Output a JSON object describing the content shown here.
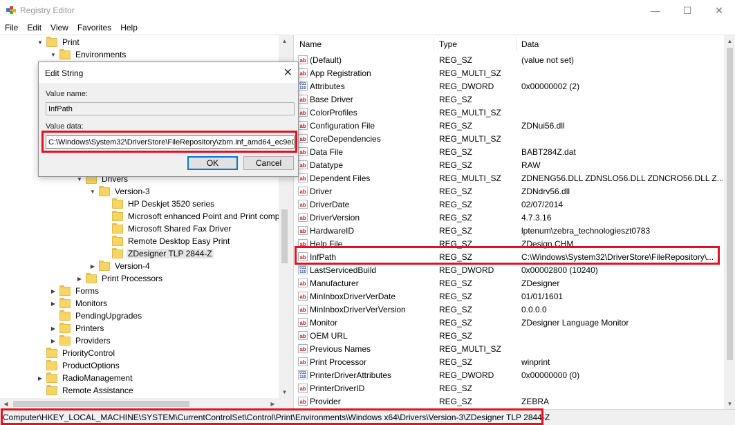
{
  "window": {
    "title": "Registry Editor",
    "minimize": "—",
    "maximize": "☐",
    "close": "✕"
  },
  "menu": [
    "File",
    "Edit",
    "View",
    "Favorites",
    "Help"
  ],
  "tree": [
    {
      "label": "Print",
      "depth": 3,
      "chev": "down"
    },
    {
      "label": "Environments",
      "depth": 4,
      "chev": "down"
    },
    {
      "label": "",
      "depth": 5,
      "chev": "none"
    },
    {
      "label": "",
      "depth": 5,
      "chev": "none"
    },
    {
      "label": "",
      "depth": 5,
      "chev": "none"
    },
    {
      "label": "",
      "depth": 5,
      "chev": "none"
    },
    {
      "label": "",
      "depth": 5,
      "chev": "none"
    },
    {
      "label": "",
      "depth": 5,
      "chev": "none"
    },
    {
      "label": "",
      "depth": 5,
      "chev": "none"
    },
    {
      "label": "",
      "depth": 5,
      "chev": "none"
    },
    {
      "label": "",
      "depth": 5,
      "chev": "none"
    },
    {
      "label": "Drivers",
      "depth": 6,
      "chev": "down"
    },
    {
      "label": "Version-3",
      "depth": 7,
      "chev": "down"
    },
    {
      "label": "HP Deskjet 3520 series",
      "depth": 8,
      "chev": "none"
    },
    {
      "label": "Microsoft enhanced Point and Print compa",
      "depth": 8,
      "chev": "none"
    },
    {
      "label": "Microsoft Shared Fax Driver",
      "depth": 8,
      "chev": "none"
    },
    {
      "label": "Remote Desktop Easy Print",
      "depth": 8,
      "chev": "none"
    },
    {
      "label": "ZDesigner TLP 2844-Z",
      "depth": 8,
      "chev": "none",
      "selected": true
    },
    {
      "label": "Version-4",
      "depth": 7,
      "chev": "right"
    },
    {
      "label": "Print Processors",
      "depth": 6,
      "chev": "right"
    },
    {
      "label": "Forms",
      "depth": 4,
      "chev": "right"
    },
    {
      "label": "Monitors",
      "depth": 4,
      "chev": "right"
    },
    {
      "label": "PendingUpgrades",
      "depth": 4,
      "chev": "none"
    },
    {
      "label": "Printers",
      "depth": 4,
      "chev": "right"
    },
    {
      "label": "Providers",
      "depth": 4,
      "chev": "right"
    },
    {
      "label": "PriorityControl",
      "depth": 3,
      "chev": "none"
    },
    {
      "label": "ProductOptions",
      "depth": 3,
      "chev": "none"
    },
    {
      "label": "RadioManagement",
      "depth": 3,
      "chev": "right"
    },
    {
      "label": "Remote Assistance",
      "depth": 3,
      "chev": "none"
    }
  ],
  "columns": {
    "name": "Name",
    "type": "Type",
    "data": "Data"
  },
  "values": [
    {
      "name": "(Default)",
      "type": "REG_SZ",
      "data": "(value not set)",
      "icon": "string"
    },
    {
      "name": "App Registration",
      "type": "REG_MULTI_SZ",
      "data": "",
      "icon": "string"
    },
    {
      "name": "Attributes",
      "type": "REG_DWORD",
      "data": "0x00000002 (2)",
      "icon": "binary"
    },
    {
      "name": "Base Driver",
      "type": "REG_SZ",
      "data": "",
      "icon": "string"
    },
    {
      "name": "ColorProfiles",
      "type": "REG_MULTI_SZ",
      "data": "",
      "icon": "string"
    },
    {
      "name": "Configuration File",
      "type": "REG_SZ",
      "data": "ZDNui56.dll",
      "icon": "string"
    },
    {
      "name": "CoreDependencies",
      "type": "REG_MULTI_SZ",
      "data": "",
      "icon": "string"
    },
    {
      "name": "Data File",
      "type": "REG_SZ",
      "data": "BABT284Z.dat",
      "icon": "string"
    },
    {
      "name": "Datatype",
      "type": "REG_SZ",
      "data": "RAW",
      "icon": "string"
    },
    {
      "name": "Dependent Files",
      "type": "REG_MULTI_SZ",
      "data": "ZDNENG56.DLL ZDNSLO56.DLL ZDNCRO56.DLL Z...",
      "icon": "string"
    },
    {
      "name": "Driver",
      "type": "REG_SZ",
      "data": "ZDNdrv56.dll",
      "icon": "string"
    },
    {
      "name": "DriverDate",
      "type": "REG_SZ",
      "data": "02/07/2014",
      "icon": "string"
    },
    {
      "name": "DriverVersion",
      "type": "REG_SZ",
      "data": "4.7.3.16",
      "icon": "string"
    },
    {
      "name": "HardwareID",
      "type": "REG_SZ",
      "data": "lptenum\\zebra_technologieszt0783",
      "icon": "string"
    },
    {
      "name": "Help File",
      "type": "REG_SZ",
      "data": "ZDesign.CHM",
      "icon": "string"
    },
    {
      "name": "InfPath",
      "type": "REG_SZ",
      "data": "C:\\Windows\\System32\\DriverStore\\FileRepository\\...",
      "icon": "string"
    },
    {
      "name": "LastServicedBuild",
      "type": "REG_DWORD",
      "data": "0x00002800 (10240)",
      "icon": "binary"
    },
    {
      "name": "Manufacturer",
      "type": "REG_SZ",
      "data": "ZDesigner",
      "icon": "string"
    },
    {
      "name": "MinInboxDriverVerDate",
      "type": "REG_SZ",
      "data": "01/01/1601",
      "icon": "string"
    },
    {
      "name": "MinInboxDriverVerVersion",
      "type": "REG_SZ",
      "data": "0.0.0.0",
      "icon": "string"
    },
    {
      "name": "Monitor",
      "type": "REG_SZ",
      "data": "ZDesigner Language Monitor",
      "icon": "string"
    },
    {
      "name": "OEM URL",
      "type": "REG_SZ",
      "data": "",
      "icon": "string"
    },
    {
      "name": "Previous Names",
      "type": "REG_MULTI_SZ",
      "data": "",
      "icon": "string"
    },
    {
      "name": "Print Processor",
      "type": "REG_SZ",
      "data": "winprint",
      "icon": "string"
    },
    {
      "name": "PrinterDriverAttributes",
      "type": "REG_DWORD",
      "data": "0x00000000 (0)",
      "icon": "binary"
    },
    {
      "name": "PrinterDriverID",
      "type": "REG_SZ",
      "data": "",
      "icon": "string"
    },
    {
      "name": "Provider",
      "type": "REG_SZ",
      "data": "ZEBRA",
      "icon": "string"
    }
  ],
  "dialog": {
    "title": "Edit String",
    "value_name_label": "Value name:",
    "value_name": "InfPath",
    "value_data_label": "Value data:",
    "value_data": "C:\\Windows\\System32\\DriverStore\\FileRepository\\zbrn.inf_amd64_ec9e0",
    "ok": "OK",
    "cancel": "Cancel"
  },
  "status": {
    "path": "Computer\\HKEY_LOCAL_MACHINE\\SYSTEM\\CurrentControlSet\\Control\\Print\\Environments\\Windows x64\\Drivers\\Version-3\\ZDesigner TLP 2844-Z"
  },
  "colors": {
    "highlight": "#e5101f",
    "folder": "#f7d565",
    "selected_row": "#e5e5e5"
  }
}
